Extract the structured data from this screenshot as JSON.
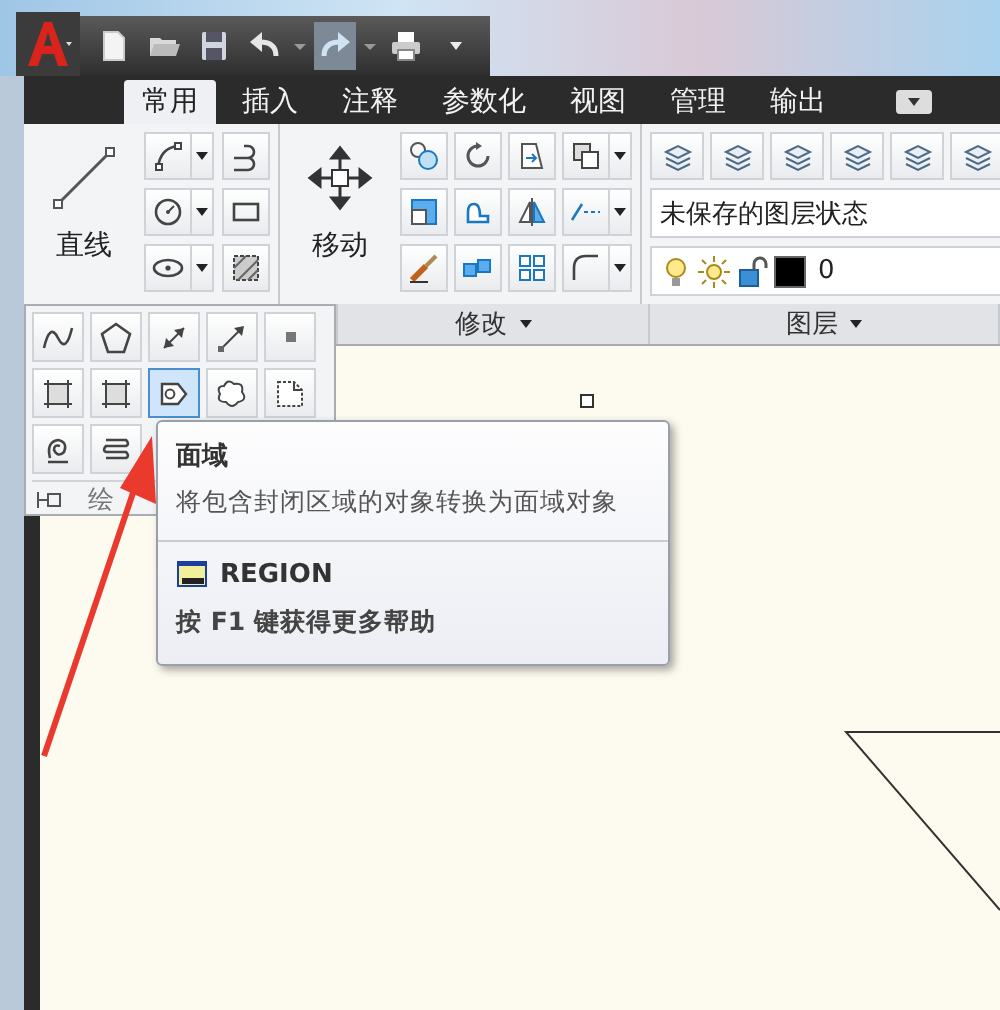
{
  "tabs": [
    {
      "label": "常用",
      "selected": true
    },
    {
      "label": "插入",
      "selected": false
    },
    {
      "label": "注释",
      "selected": false
    },
    {
      "label": "参数化",
      "selected": false
    },
    {
      "label": "视图",
      "selected": false
    },
    {
      "label": "管理",
      "selected": false
    },
    {
      "label": "输出",
      "selected": false
    }
  ],
  "ribbon": {
    "line_button": "直线",
    "move_button": "移动",
    "modify_title": "修改",
    "layer_title": "图层",
    "layer_state": {
      "value": "未保存的图层状态"
    },
    "layer_control": {
      "value": "0"
    }
  },
  "draw_flyout": {
    "title": "绘",
    "tools": [
      {
        "kind": "spline",
        "selected": false
      },
      {
        "kind": "polygon",
        "selected": false
      },
      {
        "kind": "dimension",
        "selected": false
      },
      {
        "kind": "ray",
        "selected": false
      },
      {
        "kind": "point",
        "selected": false
      },
      {
        "kind": "boundary",
        "selected": false
      },
      {
        "kind": "boundary",
        "selected": false
      },
      {
        "kind": "region",
        "selected": true
      },
      {
        "kind": "cloud",
        "selected": false
      },
      {
        "kind": "wipeout",
        "selected": false
      },
      {
        "kind": "helix",
        "selected": false
      },
      {
        "kind": "coil",
        "selected": false
      }
    ]
  },
  "tooltip": {
    "title": "面域",
    "description": "将包含封闭区域的对象转换为面域对象",
    "command": "REGION",
    "help": "按 F1 键获得更多帮助"
  }
}
